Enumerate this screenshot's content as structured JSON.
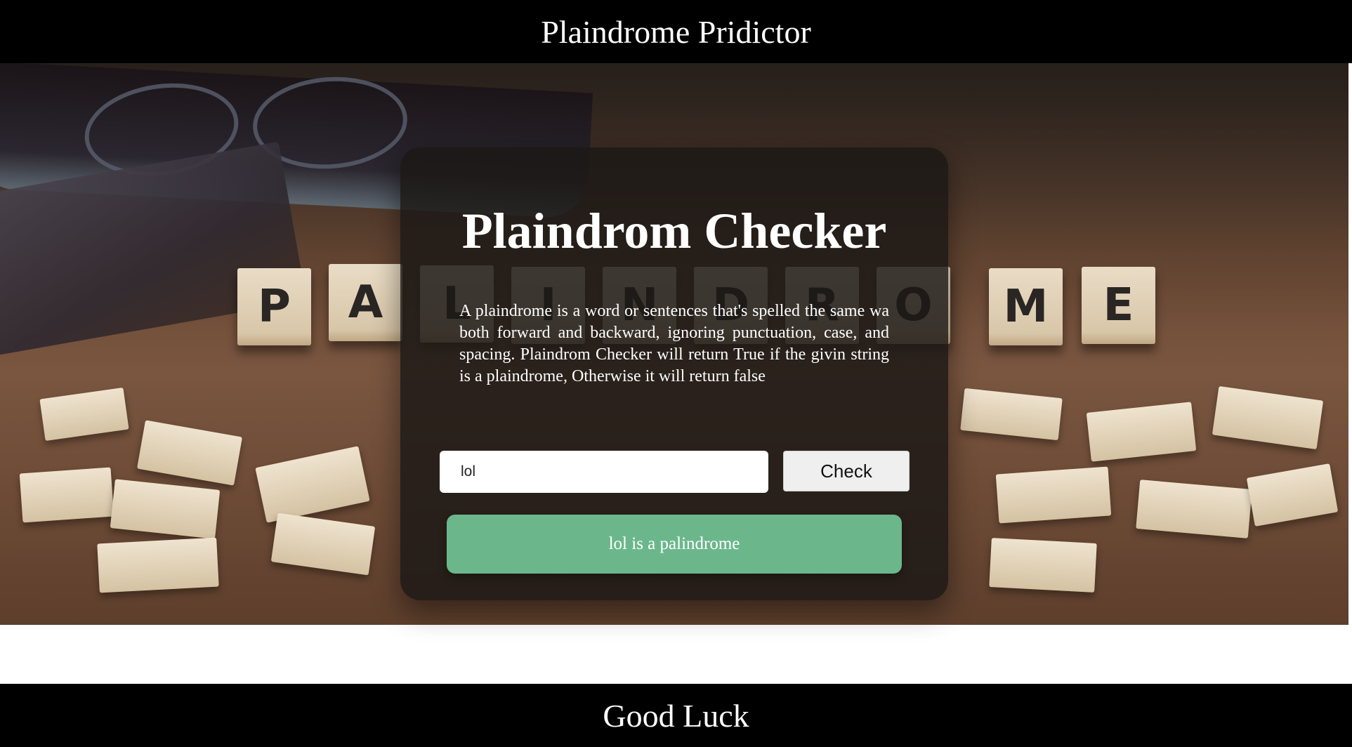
{
  "header": {
    "title": "Plaindrome Pridictor"
  },
  "hero": {
    "tile_letters": [
      "P",
      "A",
      "L",
      "I",
      "N",
      "D",
      "R",
      "O",
      "M",
      "E"
    ]
  },
  "card": {
    "title": "Plaindrom Checker",
    "description": "A plaindrome is a word or sentences that's spelled the same wa both forward and backward, ignoring punctuation, case, and spacing. Plaindrom Checker will return True if the givin string is a plaindrome, Otherwise it will return false",
    "input_value": "lol",
    "check_label": "Check",
    "result_text": "lol is a palindrome",
    "result_color": "#6bb78b"
  },
  "footer": {
    "text": "Good Luck"
  }
}
